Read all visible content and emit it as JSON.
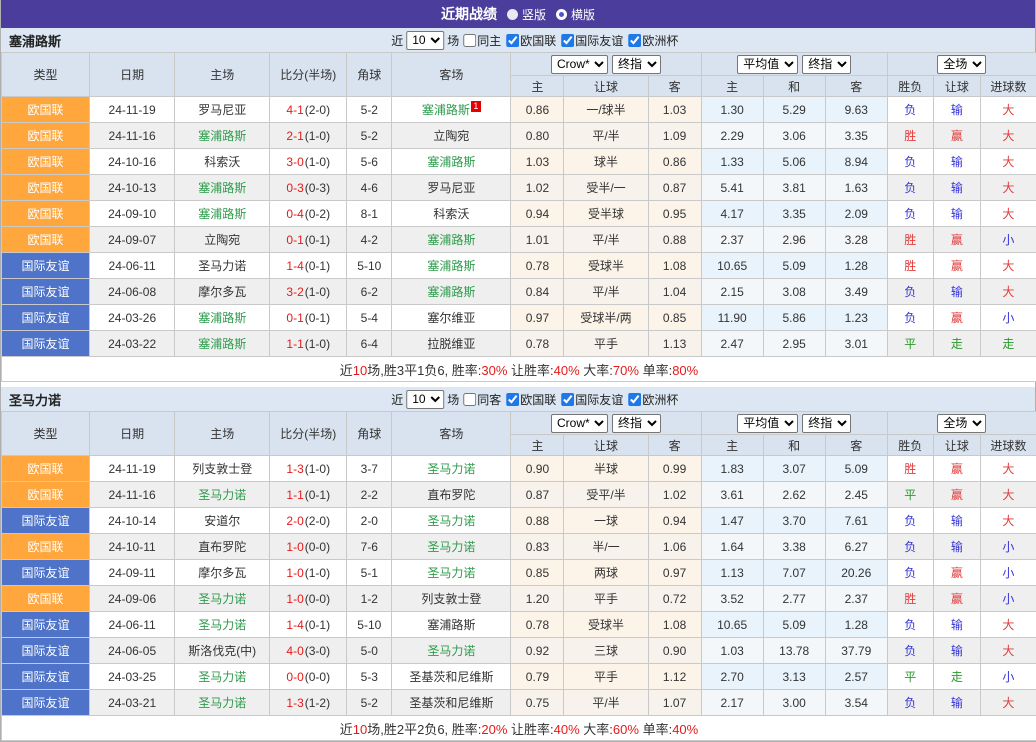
{
  "title_bar": {
    "title": "近期战绩",
    "layout_options": [
      {
        "label": "竖版",
        "selected": true
      },
      {
        "label": "横版",
        "selected": false
      }
    ]
  },
  "ui": {
    "near_label": "近",
    "games_label": "场",
    "leagues": [
      "欧国联",
      "国际友谊",
      "欧洲杯"
    ]
  },
  "columns": {
    "type": "类型",
    "date": "日期",
    "home": "主场",
    "score": "比分(半场)",
    "corner": "角球",
    "away": "客场",
    "h": "主",
    "handicap": "让球",
    "a": "客",
    "avg_h": "主",
    "avg_d": "和",
    "avg_a": "客",
    "outcome": "胜负",
    "handicap_result": "让球",
    "goals": "进球数"
  },
  "dropdowns": {
    "source": "Crow*",
    "final": "终指",
    "average": "平均值",
    "scope": "全场"
  },
  "value_colors": {
    "胜": "red",
    "平": "green",
    "负": "blue",
    "赢": "red",
    "输": "blue",
    "走": "green",
    "大": "red",
    "小": "blue"
  },
  "league_colors": {
    "欧国联": "#ffa63d",
    "国际友谊": "#4e73c8"
  },
  "colors": {
    "red": "#e23b3b",
    "blue": "#3434d8",
    "green": "#2a9a2a",
    "score_red": "#e61a1a",
    "focus_green": "#2e9b4c",
    "title_purple": "#4a3d9b"
  },
  "sections": [
    {
      "team": "塞浦路斯",
      "filter": {
        "count": "10",
        "same_label": "同主",
        "same_checked": false
      },
      "rows": [
        {
          "league": "欧国联",
          "date": "24-11-19",
          "home": "罗马尼亚",
          "home_focus": false,
          "score": "4-1",
          "half": "(2-0)",
          "corner": "5-2",
          "away": "塞浦路斯",
          "away_focus": true,
          "away_badge": "1",
          "odds": [
            "0.86",
            "一/球半",
            "1.03"
          ],
          "avg": [
            "1.30",
            "5.29",
            "9.63"
          ],
          "results": [
            "负",
            "输",
            "大"
          ]
        },
        {
          "league": "欧国联",
          "date": "24-11-16",
          "home": "塞浦路斯",
          "home_focus": true,
          "score": "2-1",
          "half": "(1-0)",
          "corner": "5-2",
          "away": "立陶宛",
          "away_focus": false,
          "odds": [
            "0.80",
            "平/半",
            "1.09"
          ],
          "avg": [
            "2.29",
            "3.06",
            "3.35"
          ],
          "results": [
            "胜",
            "赢",
            "大"
          ]
        },
        {
          "league": "欧国联",
          "date": "24-10-16",
          "home": "科索沃",
          "home_focus": false,
          "score": "3-0",
          "half": "(1-0)",
          "corner": "5-6",
          "away": "塞浦路斯",
          "away_focus": true,
          "odds": [
            "1.03",
            "球半",
            "0.86"
          ],
          "avg": [
            "1.33",
            "5.06",
            "8.94"
          ],
          "results": [
            "负",
            "输",
            "大"
          ]
        },
        {
          "league": "欧国联",
          "date": "24-10-13",
          "home": "塞浦路斯",
          "home_focus": true,
          "score": "0-3",
          "half": "(0-3)",
          "corner": "4-6",
          "away": "罗马尼亚",
          "away_focus": false,
          "odds": [
            "1.02",
            "受半/一",
            "0.87"
          ],
          "avg": [
            "5.41",
            "3.81",
            "1.63"
          ],
          "results": [
            "负",
            "输",
            "大"
          ]
        },
        {
          "league": "欧国联",
          "date": "24-09-10",
          "home": "塞浦路斯",
          "home_focus": true,
          "score": "0-4",
          "half": "(0-2)",
          "corner": "8-1",
          "away": "科索沃",
          "away_focus": false,
          "odds": [
            "0.94",
            "受半球",
            "0.95"
          ],
          "avg": [
            "4.17",
            "3.35",
            "2.09"
          ],
          "results": [
            "负",
            "输",
            "大"
          ]
        },
        {
          "league": "欧国联",
          "date": "24-09-07",
          "home": "立陶宛",
          "home_focus": false,
          "score": "0-1",
          "half": "(0-1)",
          "corner": "4-2",
          "away": "塞浦路斯",
          "away_focus": true,
          "odds": [
            "1.01",
            "平/半",
            "0.88"
          ],
          "avg": [
            "2.37",
            "2.96",
            "3.28"
          ],
          "results": [
            "胜",
            "赢",
            "小"
          ]
        },
        {
          "league": "国际友谊",
          "date": "24-06-11",
          "home": "圣马力诺",
          "home_focus": false,
          "score": "1-4",
          "half": "(0-1)",
          "corner": "5-10",
          "away": "塞浦路斯",
          "away_focus": true,
          "odds": [
            "0.78",
            "受球半",
            "1.08"
          ],
          "avg": [
            "10.65",
            "5.09",
            "1.28"
          ],
          "results": [
            "胜",
            "赢",
            "大"
          ]
        },
        {
          "league": "国际友谊",
          "date": "24-06-08",
          "home": "摩尔多瓦",
          "home_focus": false,
          "score": "3-2",
          "half": "(1-0)",
          "corner": "6-2",
          "away": "塞浦路斯",
          "away_focus": true,
          "odds": [
            "0.84",
            "平/半",
            "1.04"
          ],
          "avg": [
            "2.15",
            "3.08",
            "3.49"
          ],
          "results": [
            "负",
            "输",
            "大"
          ]
        },
        {
          "league": "国际友谊",
          "date": "24-03-26",
          "home": "塞浦路斯",
          "home_focus": true,
          "score": "0-1",
          "half": "(0-1)",
          "corner": "5-4",
          "away": "塞尔维亚",
          "away_focus": false,
          "odds": [
            "0.97",
            "受球半/两",
            "0.85"
          ],
          "avg": [
            "11.90",
            "5.86",
            "1.23"
          ],
          "results": [
            "负",
            "赢",
            "小"
          ]
        },
        {
          "league": "国际友谊",
          "date": "24-03-22",
          "home": "塞浦路斯",
          "home_focus": true,
          "score": "1-1",
          "half": "(1-0)",
          "corner": "6-4",
          "away": "拉脱维亚",
          "away_focus": false,
          "odds": [
            "0.78",
            "平手",
            "1.13"
          ],
          "avg": [
            "2.47",
            "2.95",
            "3.01"
          ],
          "results": [
            "平",
            "走",
            "走"
          ]
        }
      ],
      "summary": [
        [
          "近",
          0
        ],
        [
          "10",
          1
        ],
        [
          "场,胜3平1负6, 胜率:",
          0
        ],
        [
          "30%",
          1
        ],
        [
          " 让胜率:",
          0
        ],
        [
          "40%",
          1
        ],
        [
          " 大率:",
          0
        ],
        [
          "70%",
          1
        ],
        [
          " 单率:",
          0
        ],
        [
          "80%",
          1
        ]
      ]
    },
    {
      "team": "圣马力诺",
      "filter": {
        "count": "10",
        "same_label": "同客",
        "same_checked": false
      },
      "rows": [
        {
          "league": "欧国联",
          "date": "24-11-19",
          "home": "列支敦士登",
          "home_focus": false,
          "score": "1-3",
          "half": "(1-0)",
          "corner": "3-7",
          "away": "圣马力诺",
          "away_focus": true,
          "odds": [
            "0.90",
            "半球",
            "0.99"
          ],
          "avg": [
            "1.83",
            "3.07",
            "5.09"
          ],
          "results": [
            "胜",
            "赢",
            "大"
          ]
        },
        {
          "league": "欧国联",
          "date": "24-11-16",
          "home": "圣马力诺",
          "home_focus": true,
          "score": "1-1",
          "half": "(0-1)",
          "corner": "2-2",
          "away": "直布罗陀",
          "away_focus": false,
          "odds": [
            "0.87",
            "受平/半",
            "1.02"
          ],
          "avg": [
            "3.61",
            "2.62",
            "2.45"
          ],
          "results": [
            "平",
            "赢",
            "大"
          ]
        },
        {
          "league": "国际友谊",
          "date": "24-10-14",
          "home": "安道尔",
          "home_focus": false,
          "score": "2-0",
          "half": "(2-0)",
          "corner": "2-0",
          "away": "圣马力诺",
          "away_focus": true,
          "odds": [
            "0.88",
            "一球",
            "0.94"
          ],
          "avg": [
            "1.47",
            "3.70",
            "7.61"
          ],
          "results": [
            "负",
            "输",
            "大"
          ]
        },
        {
          "league": "欧国联",
          "date": "24-10-11",
          "home": "直布罗陀",
          "home_focus": false,
          "score": "1-0",
          "half": "(0-0)",
          "corner": "7-6",
          "away": "圣马力诺",
          "away_focus": true,
          "odds": [
            "0.83",
            "半/一",
            "1.06"
          ],
          "avg": [
            "1.64",
            "3.38",
            "6.27"
          ],
          "results": [
            "负",
            "输",
            "小"
          ]
        },
        {
          "league": "国际友谊",
          "date": "24-09-11",
          "home": "摩尔多瓦",
          "home_focus": false,
          "score": "1-0",
          "half": "(1-0)",
          "corner": "5-1",
          "away": "圣马力诺",
          "away_focus": true,
          "odds": [
            "0.85",
            "两球",
            "0.97"
          ],
          "avg": [
            "1.13",
            "7.07",
            "20.26"
          ],
          "results": [
            "负",
            "赢",
            "小"
          ]
        },
        {
          "league": "欧国联",
          "date": "24-09-06",
          "home": "圣马力诺",
          "home_focus": true,
          "score": "1-0",
          "half": "(0-0)",
          "corner": "1-2",
          "away": "列支敦士登",
          "away_focus": false,
          "odds": [
            "1.20",
            "平手",
            "0.72"
          ],
          "avg": [
            "3.52",
            "2.77",
            "2.37"
          ],
          "results": [
            "胜",
            "赢",
            "小"
          ]
        },
        {
          "league": "国际友谊",
          "date": "24-06-11",
          "home": "圣马力诺",
          "home_focus": true,
          "score": "1-4",
          "half": "(0-1)",
          "corner": "5-10",
          "away": "塞浦路斯",
          "away_focus": false,
          "odds": [
            "0.78",
            "受球半",
            "1.08"
          ],
          "avg": [
            "10.65",
            "5.09",
            "1.28"
          ],
          "results": [
            "负",
            "输",
            "大"
          ]
        },
        {
          "league": "国际友谊",
          "date": "24-06-05",
          "home": "斯洛伐克(中)",
          "home_focus": false,
          "score": "4-0",
          "half": "(3-0)",
          "corner": "5-0",
          "away": "圣马力诺",
          "away_focus": true,
          "odds": [
            "0.92",
            "三球",
            "0.90"
          ],
          "avg": [
            "1.03",
            "13.78",
            "37.79"
          ],
          "results": [
            "负",
            "输",
            "大"
          ]
        },
        {
          "league": "国际友谊",
          "date": "24-03-25",
          "home": "圣马力诺",
          "home_focus": true,
          "score": "0-0",
          "half": "(0-0)",
          "corner": "5-3",
          "away": "圣基茨和尼维斯",
          "away_focus": false,
          "odds": [
            "0.79",
            "平手",
            "1.12"
          ],
          "avg": [
            "2.70",
            "3.13",
            "2.57"
          ],
          "results": [
            "平",
            "走",
            "小"
          ]
        },
        {
          "league": "国际友谊",
          "date": "24-03-21",
          "home": "圣马力诺",
          "home_focus": true,
          "score": "1-3",
          "half": "(1-2)",
          "corner": "5-2",
          "away": "圣基茨和尼维斯",
          "away_focus": false,
          "odds": [
            "0.75",
            "平/半",
            "1.07"
          ],
          "avg": [
            "2.17",
            "3.00",
            "3.54"
          ],
          "results": [
            "负",
            "输",
            "大"
          ]
        }
      ],
      "summary": [
        [
          "近",
          0
        ],
        [
          "10",
          1
        ],
        [
          "场,胜2平2负6, 胜率:",
          0
        ],
        [
          "20%",
          1
        ],
        [
          " 让胜率:",
          0
        ],
        [
          "40%",
          1
        ],
        [
          " 大率:",
          0
        ],
        [
          "60%",
          1
        ],
        [
          " 单率:",
          0
        ],
        [
          "40%",
          1
        ]
      ]
    }
  ]
}
